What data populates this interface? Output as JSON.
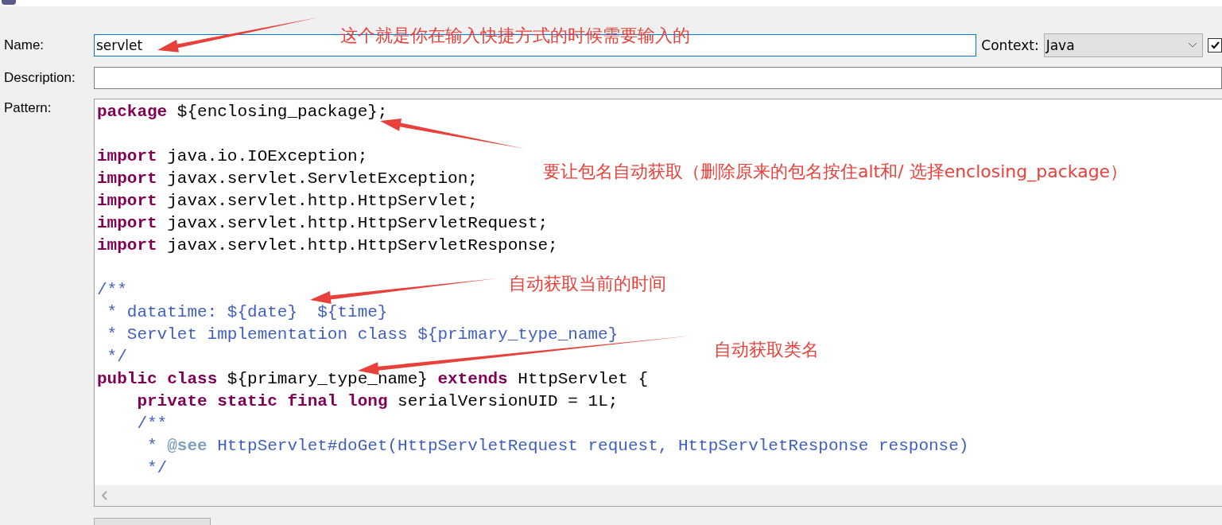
{
  "form": {
    "name_label": "Name:",
    "name_value": "servlet",
    "context_label": "Context:",
    "context_value": "Java",
    "auto_insert": {
      "checked": true
    },
    "description_label": "Description:",
    "pattern_label": "Pattern:"
  },
  "pattern": [
    {
      "tokens": [
        {
          "kind": "keyword",
          "text": "package"
        },
        {
          "kind": "plain",
          "text": " ${enclosing_package};"
        }
      ]
    },
    {
      "kind": "blank"
    },
    {
      "tokens": [
        {
          "kind": "keyword",
          "text": "import"
        },
        {
          "kind": "plain",
          "text": " java.io.IOException;"
        }
      ]
    },
    {
      "tokens": [
        {
          "kind": "keyword",
          "text": "import"
        },
        {
          "kind": "plain",
          "text": " javax.servlet.ServletException;"
        }
      ]
    },
    {
      "tokens": [
        {
          "kind": "keyword",
          "text": "import"
        },
        {
          "kind": "plain",
          "text": " javax.servlet.http.HttpServlet;"
        }
      ]
    },
    {
      "tokens": [
        {
          "kind": "keyword",
          "text": "import"
        },
        {
          "kind": "plain",
          "text": " javax.servlet.http.HttpServletRequest;"
        }
      ]
    },
    {
      "tokens": [
        {
          "kind": "keyword",
          "text": "import"
        },
        {
          "kind": "plain",
          "text": " javax.servlet.http.HttpServletResponse;"
        }
      ]
    },
    {
      "kind": "blank"
    },
    {
      "tokens": [
        {
          "kind": "doc",
          "text": "/**"
        }
      ]
    },
    {
      "tokens": [
        {
          "kind": "doc",
          "text": " * datatime: ${date}  ${time}"
        }
      ]
    },
    {
      "tokens": [
        {
          "kind": "doc",
          "text": " * Servlet implementation class ${primary_type_name}"
        }
      ]
    },
    {
      "tokens": [
        {
          "kind": "doc",
          "text": " */"
        }
      ]
    },
    {
      "tokens": [
        {
          "kind": "keyword",
          "text": "public"
        },
        {
          "kind": "keyword",
          "text": " class"
        },
        {
          "kind": "plain",
          "text": " ${primary_type_name} "
        },
        {
          "kind": "keyword",
          "text": "extends"
        },
        {
          "kind": "plain",
          "text": " HttpServlet {"
        }
      ]
    },
    {
      "tokens": [
        {
          "kind": "keyword",
          "text": "    private"
        },
        {
          "kind": "keyword",
          "text": " static"
        },
        {
          "kind": "keyword",
          "text": " final"
        },
        {
          "kind": "keyword",
          "text": " long"
        },
        {
          "kind": "plain",
          "text": " serialVersionUID = 1L;"
        }
      ]
    },
    {
      "tokens": [
        {
          "kind": "doc",
          "text": "    /**"
        }
      ]
    },
    {
      "tokens": [
        {
          "kind": "doc",
          "text": "     * "
        },
        {
          "kind": "tag",
          "text": "@see"
        },
        {
          "kind": "doc",
          "text": " HttpServlet#doGet(HttpServletRequest request, HttpServletResponse response)"
        }
      ]
    },
    {
      "tokens": [
        {
          "kind": "doc",
          "text": "     */"
        }
      ]
    }
  ],
  "annotations": [
    {
      "text": "这个就是你在输入快捷方式的时候需要输入的"
    },
    {
      "text": "要让包名自动获取（删除原来的包名按住alt和/ 选择enclosing_package）"
    },
    {
      "text": "自动获取当前的时间"
    },
    {
      "text": "自动获取类名"
    }
  ]
}
